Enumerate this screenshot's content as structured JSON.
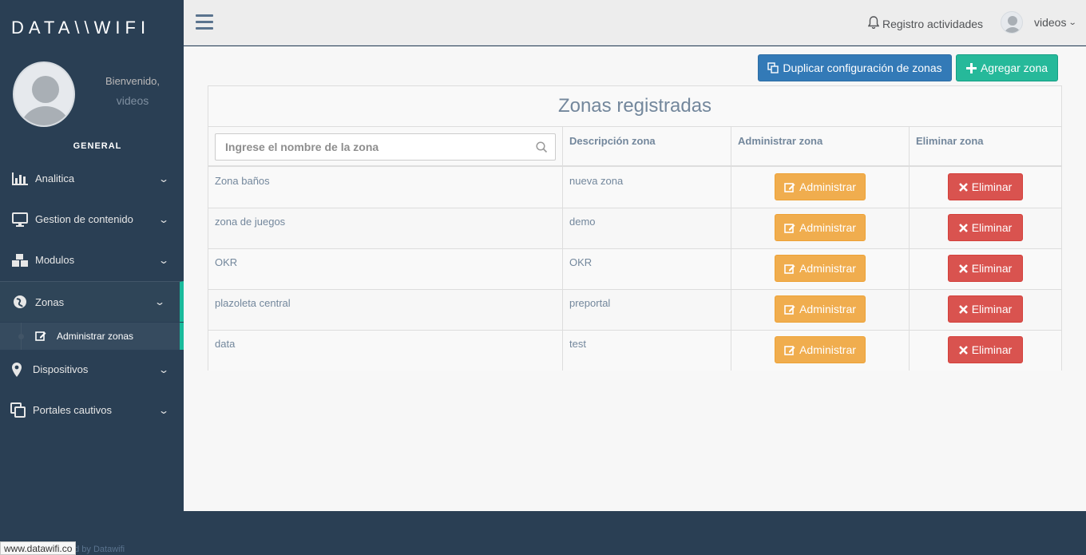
{
  "brand": {
    "logo_text": "DATA\\\\WIFI"
  },
  "profile": {
    "welcome": "Bienvenido,",
    "username": "videos"
  },
  "sidebar": {
    "section": "GENERAL",
    "items": [
      {
        "label": "Analitica",
        "icon": "bar-chart-icon"
      },
      {
        "label": "Gestion de contenido",
        "icon": "desktop-icon"
      },
      {
        "label": "Modulos",
        "icon": "cubes-icon"
      },
      {
        "label": "Zonas",
        "icon": "globe-icon"
      },
      {
        "label": "Dispositivos",
        "icon": "map-marker-icon"
      },
      {
        "label": "Portales cautivos",
        "icon": "clone-icon"
      }
    ],
    "submenu": {
      "label": "Administrar zonas",
      "icon": "edit-icon"
    }
  },
  "topbar": {
    "notifications": "Registro actividades",
    "user": "videos"
  },
  "actions": {
    "duplicate": "Duplicar configuración de zonas",
    "add": "Agregar zona"
  },
  "table": {
    "title": "Zonas registradas",
    "search_placeholder": "Ingrese el nombre de la zona",
    "headers": {
      "description": "Descripción zona",
      "manage": "Administrar zona",
      "delete": "Eliminar zona"
    },
    "manage_label": "Administrar",
    "delete_label": "Eliminar",
    "rows": [
      {
        "name": "Zona baños",
        "description": "nueva zona"
      },
      {
        "name": "zona de juegos",
        "description": "demo"
      },
      {
        "name": "OKR",
        "description": "OKR"
      },
      {
        "name": "plazoleta central",
        "description": "preportal"
      },
      {
        "name": "data",
        "description": "test"
      }
    ]
  },
  "footer": {
    "link": "www.datawifi.co",
    "text": "ed by Datawifi"
  },
  "colors": {
    "sidebar": "#2a3f54",
    "accent": "#1abb9c",
    "primary": "#337ab7",
    "success": "#26b99a",
    "warning": "#f0ad4e",
    "danger": "#d9534f"
  }
}
